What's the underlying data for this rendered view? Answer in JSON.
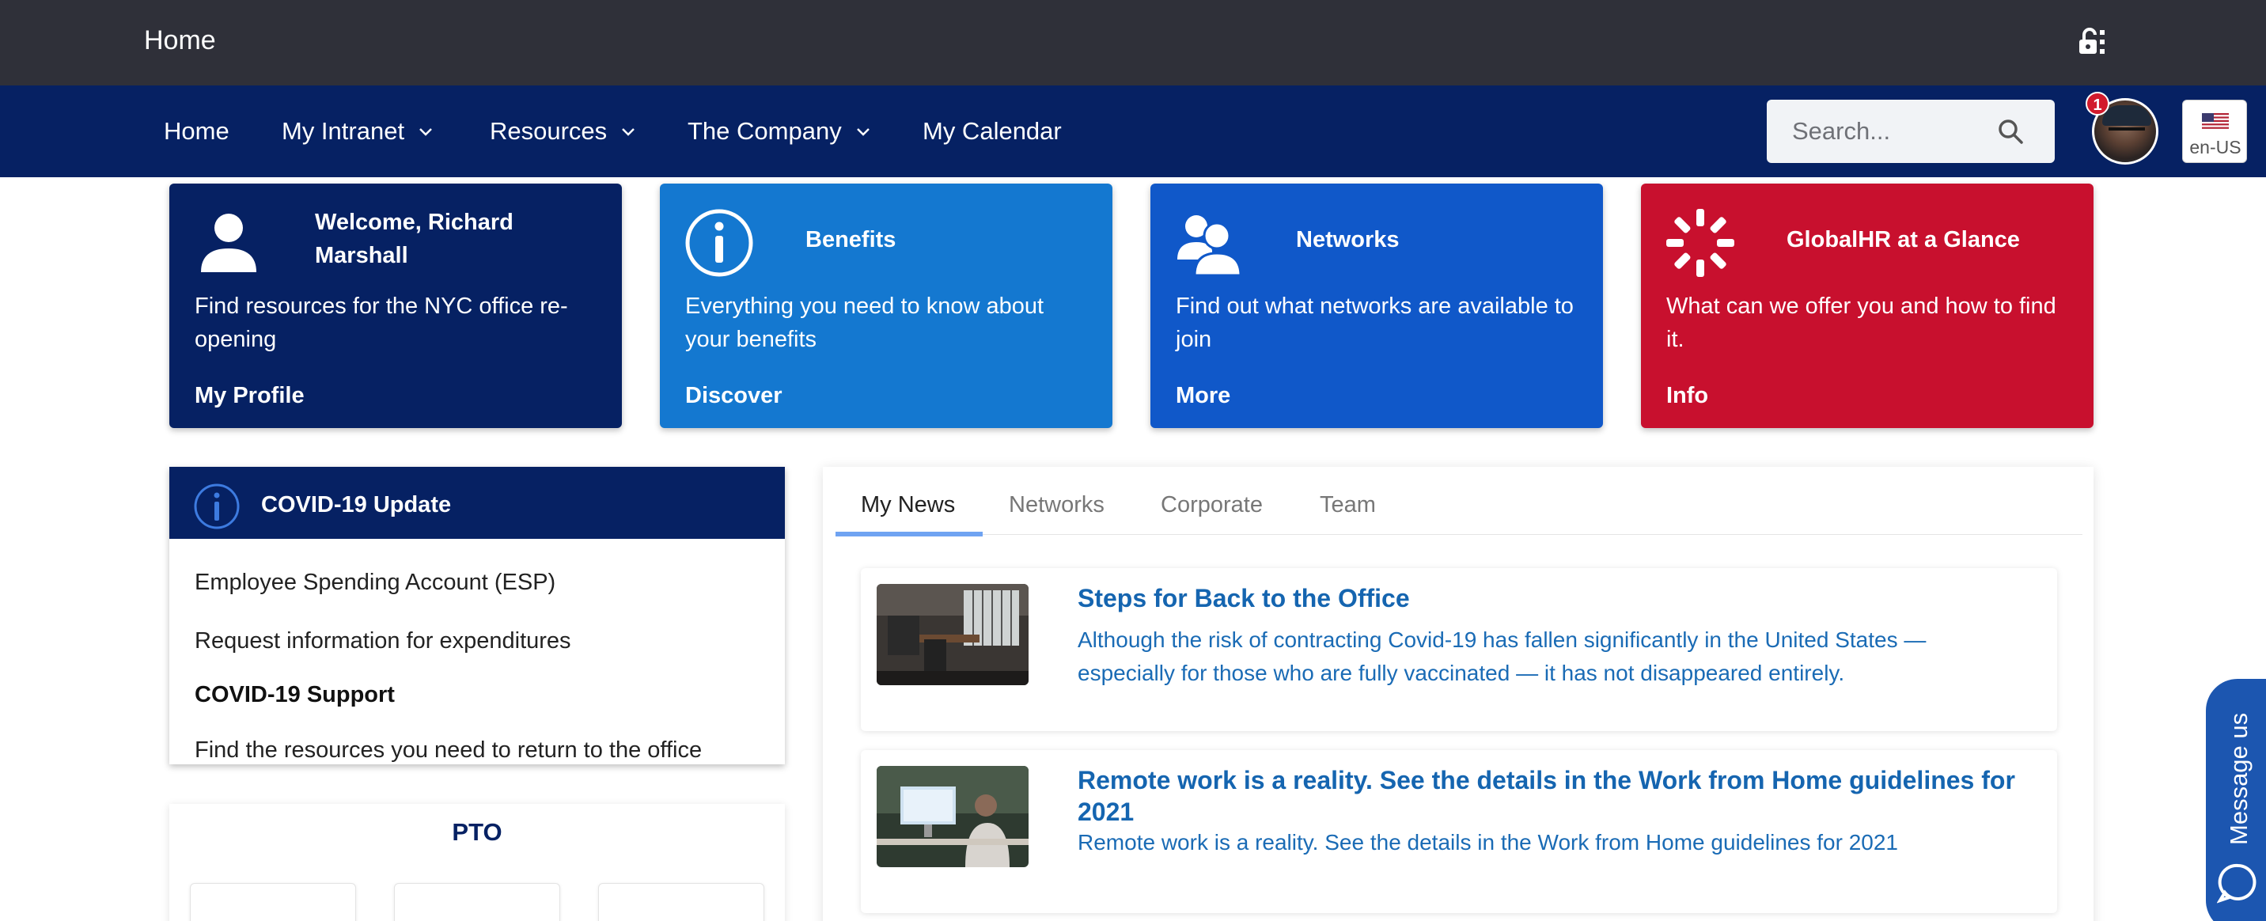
{
  "topbar": {
    "title": "Home"
  },
  "nav": {
    "items": [
      {
        "label": "Home",
        "has_dropdown": false
      },
      {
        "label": "My Intranet",
        "has_dropdown": true
      },
      {
        "label": "Resources",
        "has_dropdown": true
      },
      {
        "label": "The Company",
        "has_dropdown": true
      },
      {
        "label": "My Calendar",
        "has_dropdown": false
      }
    ],
    "search": {
      "placeholder": "Search..."
    },
    "notification_count": "1",
    "language": "en-US"
  },
  "cards": [
    {
      "title": "Welcome, Richard Marshall",
      "description": "Find resources for the NYC office re-opening",
      "link": "My Profile",
      "color": "#062163",
      "icon": "user-icon"
    },
    {
      "title": "Benefits",
      "description": "Everything you need to know about your benefits",
      "link": "Discover",
      "color": "#1478d0",
      "icon": "info-circle-icon"
    },
    {
      "title": "Networks",
      "description": "Find out what networks are available to join",
      "link": "More",
      "color": "#1058c9",
      "icon": "users-icon"
    },
    {
      "title": "GlobalHR at a Glance",
      "description": "What can we offer you and how to find it.",
      "link": "Info",
      "color": "#c8102e",
      "icon": "spinner-icon"
    }
  ],
  "covid": {
    "title": "COVID-19 Update",
    "items": [
      {
        "text": "Employee Spending Account (ESP)",
        "bold": false
      },
      {
        "text": "Request information for expenditures",
        "bold": false
      },
      {
        "text": "COVID-19 Support",
        "bold": true
      },
      {
        "text": "Find the resources you need to return to the office",
        "bold": false
      }
    ]
  },
  "pto": {
    "title": "PTO"
  },
  "news": {
    "tabs": [
      "My News",
      "Networks",
      "Corporate",
      "Team"
    ],
    "active_tab": "My News",
    "articles": [
      {
        "title": "Steps for Back to the Office",
        "summary": "Although the risk of contracting Covid-19 has fallen significantly in the United States — especially for those who are fully vaccinated — it has not disappeared entirely.",
        "thumbnail": "office-photo"
      },
      {
        "title": "Remote work is a reality. See the details in the Work from Home guidelines for 2021",
        "summary": "Remote work is a reality. See the details in the Work from Home guidelines for 2021",
        "thumbnail": "home-office-photo"
      }
    ]
  },
  "chat": {
    "label": "Message us"
  },
  "colors": {
    "topbar": "#2f3039",
    "navbar": "#062163",
    "link": "#1565b0",
    "tab_active": "#6fa3f2",
    "badge": "#d21a2c"
  }
}
